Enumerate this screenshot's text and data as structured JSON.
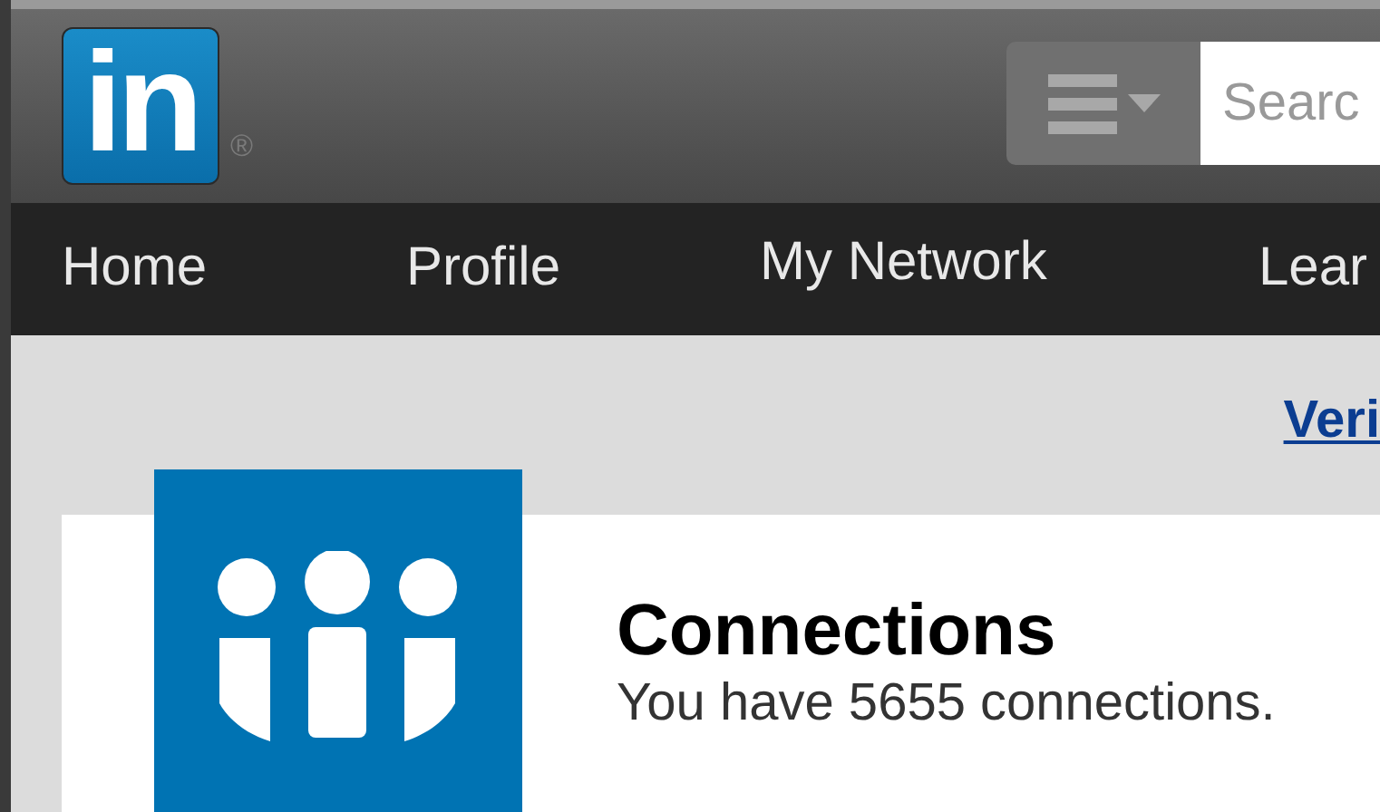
{
  "header": {
    "logo": {
      "text": "in",
      "mark": "®"
    },
    "search": {
      "placeholder": "Searc"
    }
  },
  "nav": {
    "items": [
      {
        "label": "Home"
      },
      {
        "label": "Profile"
      },
      {
        "label": "My Network"
      },
      {
        "label": "Lear"
      }
    ]
  },
  "link": "Veri",
  "card": {
    "title": "Connections",
    "subtitle": "You have 5655 connections."
  }
}
